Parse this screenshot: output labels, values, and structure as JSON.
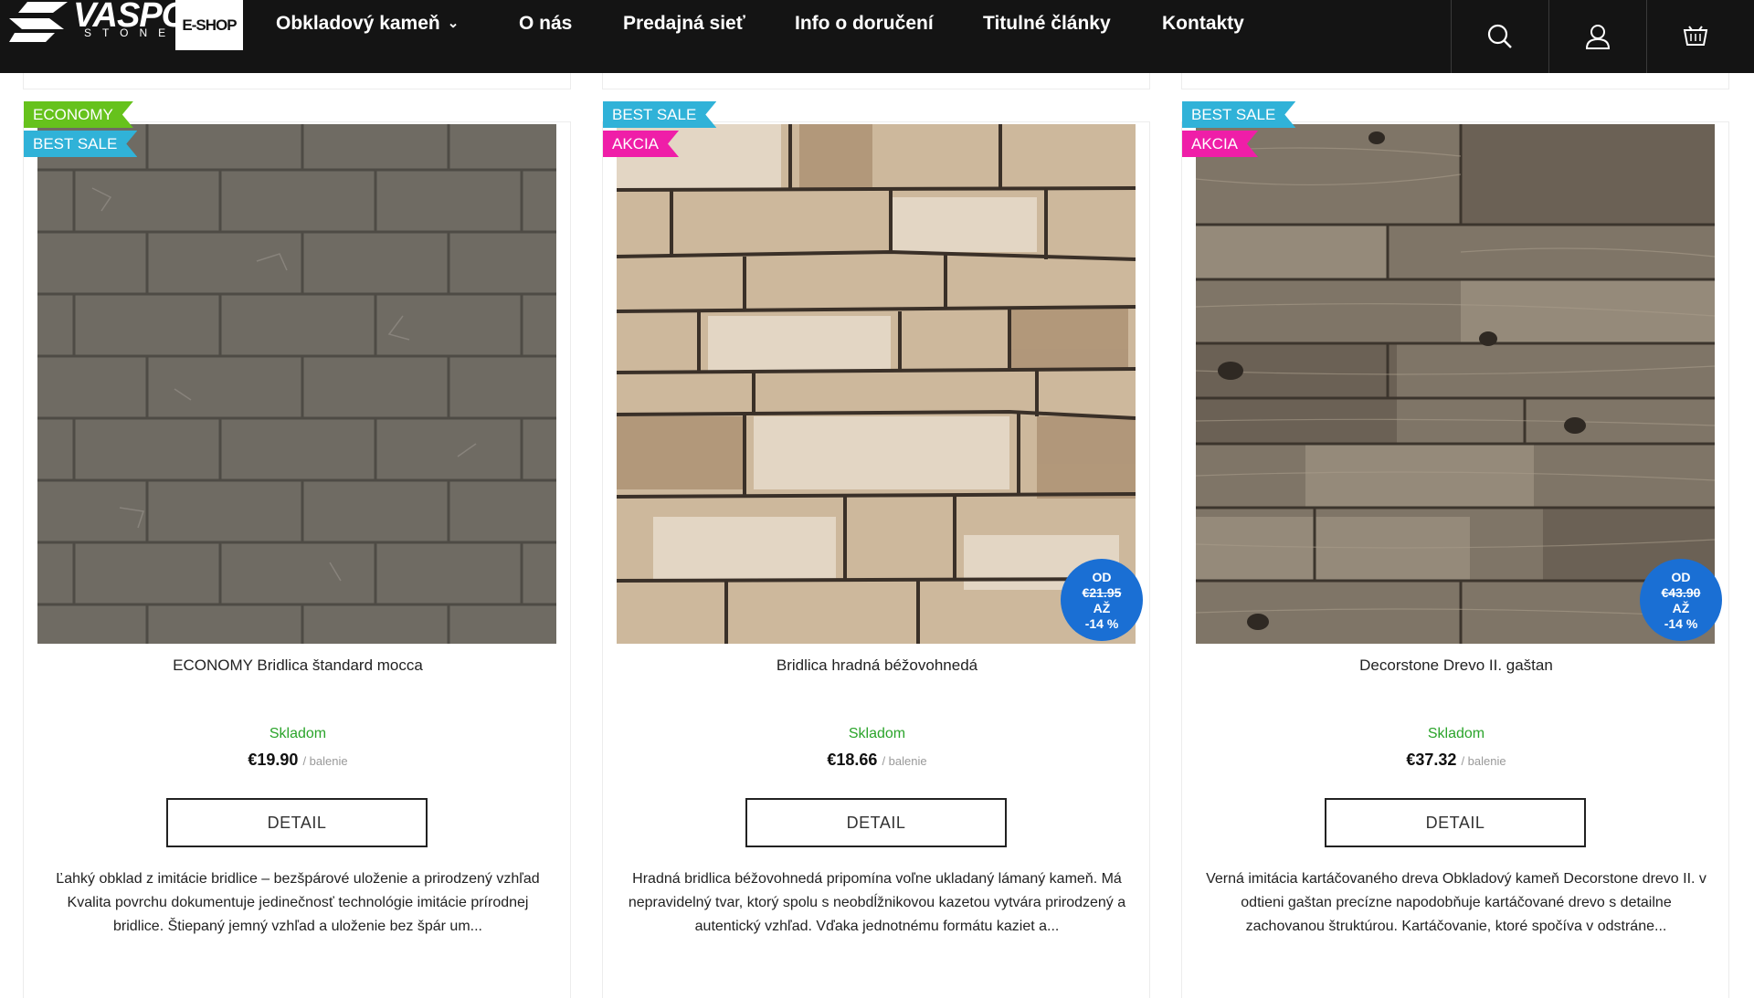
{
  "nav": {
    "logo_text": "VASPO",
    "logo_sub": "STONE",
    "eshop_label": "E-SHOP",
    "items": [
      {
        "label": "Obkladový kameň",
        "has_dropdown": true
      },
      {
        "label": "O nás"
      },
      {
        "label": "Predajná sieť"
      },
      {
        "label": "Info o doručení"
      },
      {
        "label": "Titulné články"
      },
      {
        "label": "Kontakty"
      }
    ],
    "icons": [
      "search-icon",
      "user-icon",
      "cart-icon"
    ]
  },
  "products": [
    {
      "badges": [
        "ECONOMY",
        "BEST SALE"
      ],
      "title": "ECONOMY Bridlica štandard mocca",
      "stock": "Skladom",
      "price": "€19.90",
      "unit": "/ balenie",
      "detail_label": "DETAIL",
      "desc": "Ľahký obklad z imitácie bridlice – bezšpárové uloženie a prirodzený vzhľad Kvalita povrchu dokumentuje jedinečnosť technológie imitácie prírodnej bridlice. Štiepaný jemný vzhľad a uloženie bez špár um...",
      "image": "gray slate tile wall"
    },
    {
      "badges": [
        "BEST SALE",
        "AKCIA"
      ],
      "title": "Bridlica hradná béžovohnedá",
      "stock": "Skladom",
      "price": "€18.66",
      "unit": "/ balenie",
      "detail_label": "DETAIL",
      "desc": "Hradná bridlica béžovohnedá pripomína voľne ukladaný lámaný kameň. Má nepravidelný tvar, ktorý spolu s neobdĺžnikovou kazetou vytvára prirodzený a autentický vzhľad. Vďaka jednotnému formátu kaziet a...",
      "discount": {
        "from": "OD",
        "old_price": "€21.95",
        "to": "AŽ",
        "percent": "-14 %"
      },
      "image": "beige stacked stone wall"
    },
    {
      "badges": [
        "BEST SALE",
        "AKCIA"
      ],
      "title": "Decorstone Drevo II. gaštan",
      "stock": "Skladom",
      "price": "€37.32",
      "unit": "/ balenie",
      "detail_label": "DETAIL",
      "desc": "Verná imitácia kartáčovaného dreva Obkladový kameň Decorstone drevo II. v odtieni gaštan precízne napodobňuje kartáčované drevo s detailne zachovanou štruktúrou. Kartáčovanie, ktoré spočíva v odstráne...",
      "discount": {
        "from": "OD",
        "old_price": "€43.90",
        "to": "AŽ",
        "percent": "-14 %"
      },
      "image": "brushed wood planks chestnut"
    }
  ],
  "colors": {
    "nav_bg": "#141414",
    "economy": "#66c21c",
    "best_sale": "#30b2d8",
    "akcia": "#ef1ea8",
    "discount": "#1a6fd4",
    "stock": "#2aa42a"
  }
}
